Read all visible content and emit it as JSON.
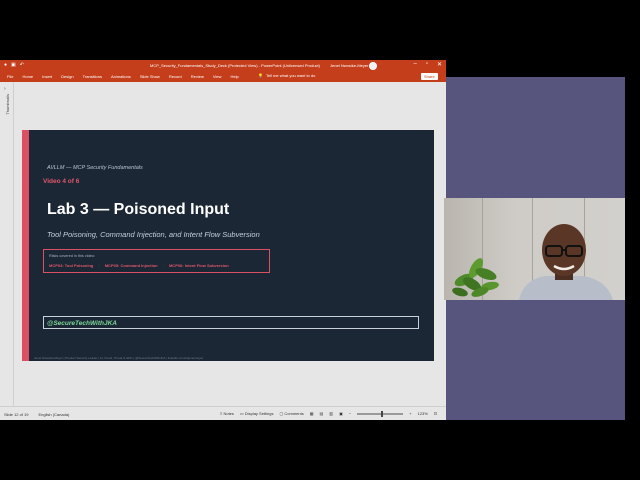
{
  "window": {
    "title": "MCP_Security_Fundamentals_Study_Deck (Protected View) - PowerPoint (Unlicensed Product)",
    "user": "Jenet Nwosike-Meyer"
  },
  "ribbon": {
    "tabs": [
      "File",
      "Home",
      "Insert",
      "Design",
      "Transitions",
      "Animations",
      "Slide Show",
      "Record",
      "Review",
      "View",
      "Help"
    ],
    "tell_me": "Tell me what you want to do",
    "share": "Share"
  },
  "thumbnails_label": "Thumbnails",
  "slide": {
    "kicker": "AI/LLM — MCP Security Fundamentals",
    "video_number": "Video 4 of 6",
    "title": "Lab 3 — Poisoned Input",
    "subtitle": "Tool Poisoning, Command Injection, and Intent Flow Subversion",
    "risks_header": "Risks covered in this video:",
    "risks": [
      "MCP03: Tool Poisoning",
      "MCP05: Command Injection",
      "MCP06: Intent Flow Subversion"
    ],
    "risk_separator": "·",
    "handle": "@SecureTechWithJKA",
    "footer": "Jenet Nwosike-Meyer | Product Security Leader | AI, Cloud, Threat & GRC | @SecureTechWithJKA | linkedin.com/in/jenetmeyer"
  },
  "statusbar": {
    "slide_count": "Slide 12 of 19",
    "language": "English (Canada)",
    "notes": "Notes",
    "display_settings": "Display Settings",
    "comments": "Comments",
    "zoom": "123%",
    "zoom_level": 0.53
  },
  "colors": {
    "ribbon": "#c43e1c",
    "slide_bg": "#1b2735",
    "accent": "#d95163",
    "handle_text": "#7fd89a",
    "video_bg": "#57557e"
  }
}
